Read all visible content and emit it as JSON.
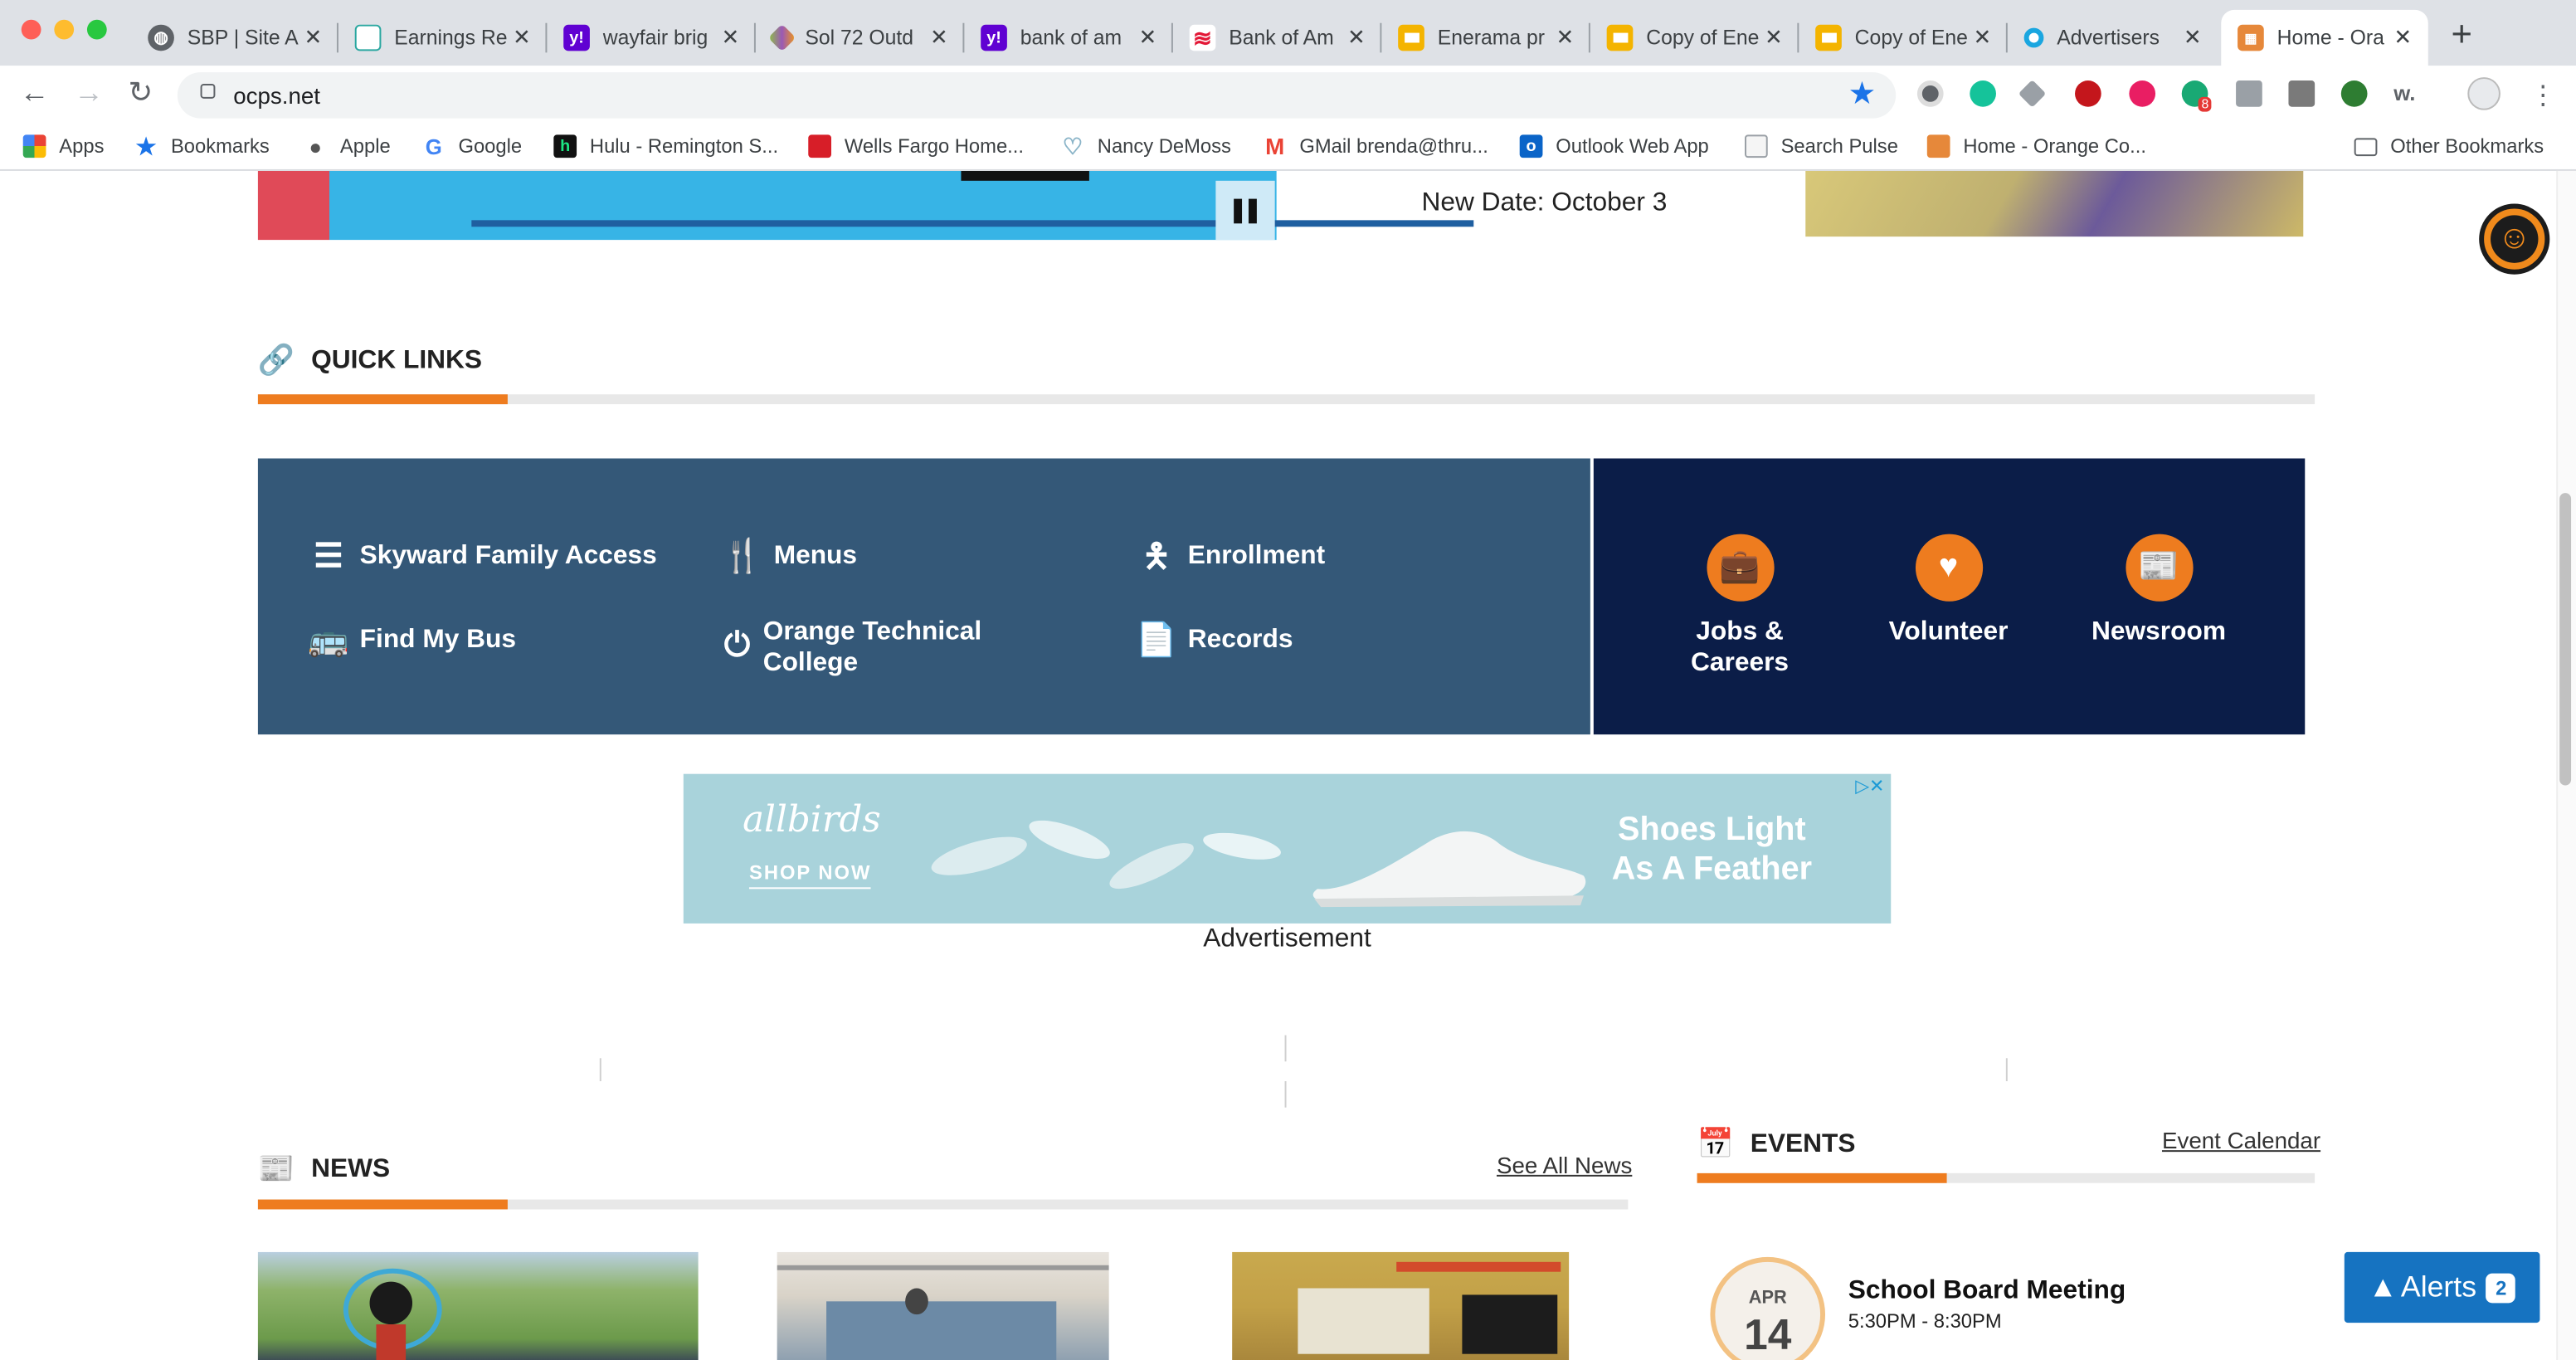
{
  "browser": {
    "tabs": [
      {
        "title": "SBP | Site A",
        "icon": "globe-icon",
        "color": "#5f6368"
      },
      {
        "title": "Earnings Re",
        "icon": "chart-icon",
        "color": "#2aa7a0"
      },
      {
        "title": "wayfair brig",
        "icon": "yahoo-icon",
        "color": "#6001d2"
      },
      {
        "title": "Sol 72 Outd",
        "icon": "sol-icon",
        "color": "#8cc63f"
      },
      {
        "title": "bank of am",
        "icon": "yahoo-icon",
        "color": "#6001d2"
      },
      {
        "title": "Bank of Am",
        "icon": "boa-icon",
        "color": "#e31837"
      },
      {
        "title": "Enerama pr",
        "icon": "slides-icon",
        "color": "#f4b400"
      },
      {
        "title": "Copy of Ene",
        "icon": "slides-icon",
        "color": "#f4b400"
      },
      {
        "title": "Copy of Ene",
        "icon": "slides-icon",
        "color": "#f4b400"
      },
      {
        "title": "Advertisers",
        "icon": "ring-icon",
        "color": "#1aa6e0"
      },
      {
        "title": "Home - Ora",
        "icon": "ocps-icon",
        "color": "#e6883a"
      }
    ],
    "url": "ocps.net",
    "bookmarks": [
      {
        "label": "Apps",
        "icon": "apps-grid-icon"
      },
      {
        "label": "Bookmarks",
        "icon": "star-icon"
      },
      {
        "label": "Apple",
        "icon": "apple-icon"
      },
      {
        "label": "Google",
        "icon": "google-icon"
      },
      {
        "label": "Hulu - Remington S...",
        "icon": "hulu-icon"
      },
      {
        "label": "Wells Fargo Home...",
        "icon": "wells-fargo-icon"
      },
      {
        "label": "Nancy DeMoss",
        "icon": "heart-icon"
      },
      {
        "label": "GMail brenda@thru...",
        "icon": "gmail-icon"
      },
      {
        "label": "Outlook Web App",
        "icon": "outlook-icon"
      },
      {
        "label": "Search Pulse",
        "icon": "doc-icon"
      },
      {
        "label": "Home - Orange Co...",
        "icon": "ocps-icon"
      }
    ],
    "other_bookmarks": "Other Bookmarks",
    "extension_badge": "8"
  },
  "page": {
    "new_date": "New Date: October 3",
    "quick_links": {
      "title": "QUICK LINKS",
      "items": [
        {
          "label": "Skyward Family Access",
          "icon": "list-icon"
        },
        {
          "label": "Menus",
          "icon": "utensils-icon"
        },
        {
          "label": "Enrollment",
          "icon": "person-icon"
        },
        {
          "label": "Find My Bus",
          "icon": "bus-icon"
        },
        {
          "label": "Orange Technical College",
          "icon": "power-icon"
        },
        {
          "label": "Records",
          "icon": "document-icon"
        }
      ],
      "featured": [
        {
          "label": "Jobs & Careers",
          "icon": "briefcase-icon"
        },
        {
          "label": "Volunteer",
          "icon": "heart-icon"
        },
        {
          "label": "Newsroom",
          "icon": "newspaper-icon"
        }
      ]
    },
    "ad": {
      "brand": "allbirds",
      "cta": "SHOP NOW",
      "tagline": "Shoes Light As A Feather",
      "label": "Advertisement"
    },
    "news": {
      "title": "NEWS",
      "see_all": "See All News"
    },
    "events": {
      "title": "EVENTS",
      "calendar_link": "Event Calendar",
      "items": [
        {
          "month": "APR",
          "day": "14",
          "title": "School Board Meeting",
          "time": "5:30PM - 8:30PM"
        }
      ]
    },
    "alerts": {
      "label": "Alerts",
      "count": "2"
    }
  }
}
